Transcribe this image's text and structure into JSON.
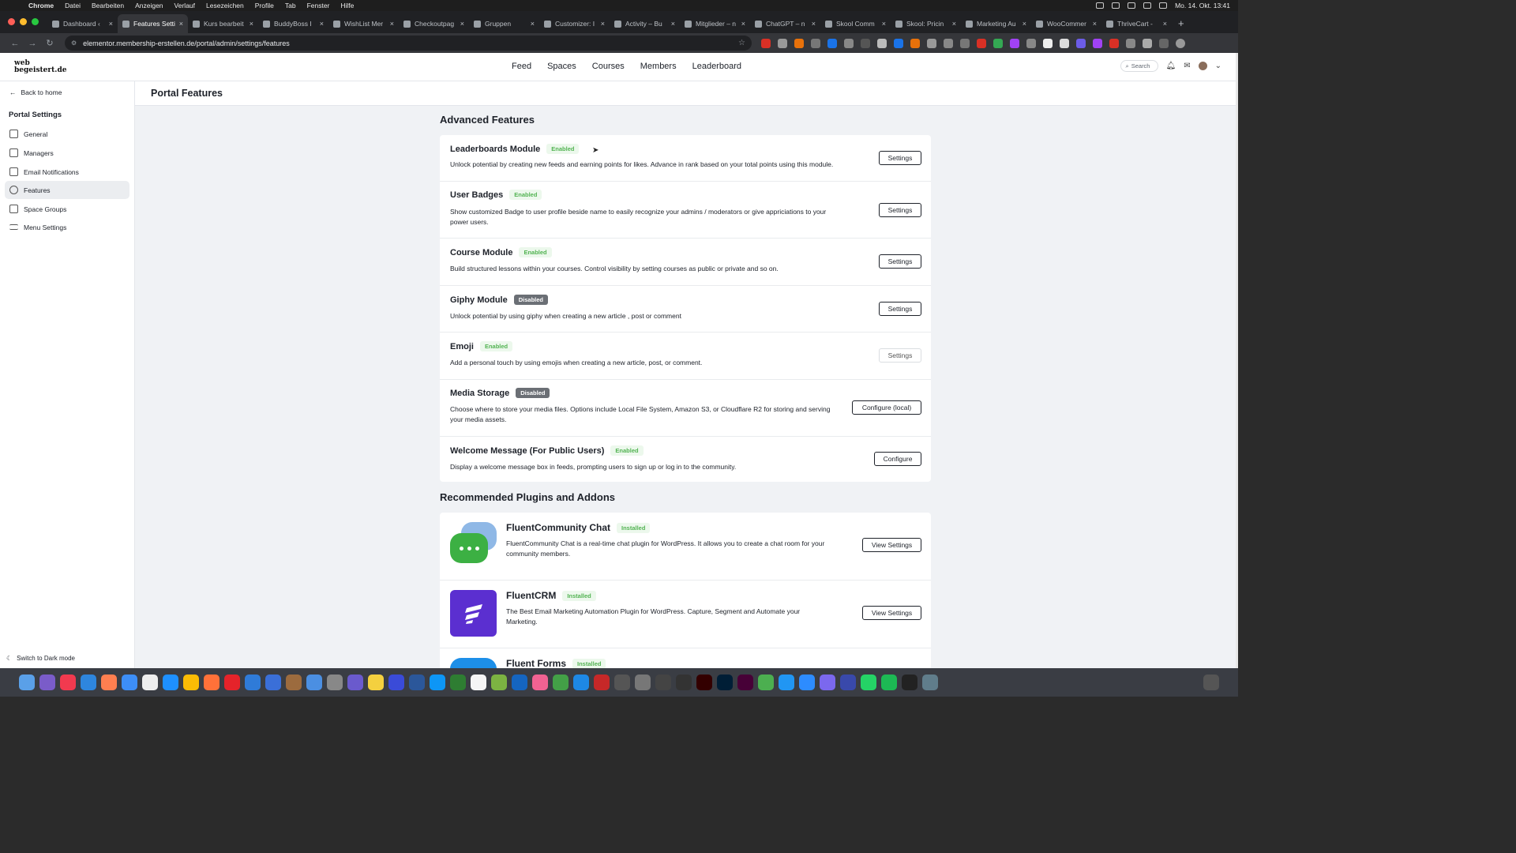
{
  "menubar": {
    "app": "Chrome",
    "items": [
      "Datei",
      "Bearbeiten",
      "Anzeigen",
      "Verlauf",
      "Lesezeichen",
      "Profile",
      "Tab",
      "Fenster",
      "Hilfe"
    ],
    "clock": "Mo. 14. Okt. 13:41"
  },
  "tabs": [
    {
      "title": "Dashboard ‹"
    },
    {
      "title": "Features Setti"
    },
    {
      "title": "Kurs bearbeit"
    },
    {
      "title": "BuddyBoss I"
    },
    {
      "title": "WishList Mer"
    },
    {
      "title": "Checkoutpag"
    },
    {
      "title": "Gruppen"
    },
    {
      "title": "Customizer: I"
    },
    {
      "title": "Activity – Bu"
    },
    {
      "title": "Mitglieder – n"
    },
    {
      "title": "ChatGPT – n"
    },
    {
      "title": "Skool Comm"
    },
    {
      "title": "Skool: Pricin"
    },
    {
      "title": "Marketing Au"
    },
    {
      "title": "WooCommer"
    },
    {
      "title": "ThriveCart -"
    }
  ],
  "address": {
    "url": "elementor.membership-erstellen.de/portal/admin/settings/features"
  },
  "site": {
    "logo_line1": "web",
    "logo_line2": "begeistert.de",
    "nav": [
      "Feed",
      "Spaces",
      "Courses",
      "Members",
      "Leaderboard"
    ],
    "search_placeholder": "Search"
  },
  "sidebar": {
    "back": "Back to home",
    "title": "Portal Settings",
    "items": [
      {
        "label": "General"
      },
      {
        "label": "Managers"
      },
      {
        "label": "Email Notifications"
      },
      {
        "label": "Features"
      },
      {
        "label": "Space Groups"
      },
      {
        "label": "Menu Settings"
      }
    ],
    "dark_mode": "Switch to Dark mode"
  },
  "page": {
    "title": "Portal Features"
  },
  "advanced": {
    "title": "Advanced Features",
    "features": [
      {
        "name": "Leaderboards Module",
        "status": "Enabled",
        "desc": "Unlock potential by creating new feeds and earning points for likes. Advance in rank based on your total points using this module.",
        "button": "Settings"
      },
      {
        "name": "User Badges",
        "status": "Enabled",
        "desc": "Show customized Badge to user profile beside name to easily recognize your admins / moderators or give appriciations to your power users.",
        "button": "Settings"
      },
      {
        "name": "Course Module",
        "status": "Enabled",
        "desc": "Build structured lessons within your courses. Control visibility by setting courses as public or private and so on.",
        "button": "Settings"
      },
      {
        "name": "Giphy Module",
        "status": "Disabled",
        "desc": "Unlock potential by using giphy when creating a new article , post or comment",
        "button": "Settings"
      },
      {
        "name": "Emoji",
        "status": "Enabled",
        "desc": "Add a personal touch by using emojis when creating a new article, post, or comment.",
        "button": "Settings"
      },
      {
        "name": "Media Storage",
        "status": "Disabled",
        "desc": "Choose where to store your media files. Options include Local File System, Amazon S3, or Cloudflare R2 for storing and serving your media assets.",
        "button": "Configure (local)"
      },
      {
        "name": "Welcome Message (For Public Users)",
        "status": "Enabled",
        "desc": "Display a welcome message box in feeds, prompting users to sign up or log in to the community.",
        "button": "Configure"
      }
    ]
  },
  "plugins": {
    "title": "Recommended Plugins and Addons",
    "items": [
      {
        "name": "FluentCommunity Chat",
        "status": "Installed",
        "desc": "FluentCommunity Chat is a real-time chat plugin for WordPress. It allows you to create a chat room for your community members.",
        "button": "View Settings"
      },
      {
        "name": "FluentCRM",
        "status": "Installed",
        "desc": "The Best Email Marketing Automation Plugin for WordPress. Capture, Segment and Automate your Marketing.",
        "button": "View Settings"
      },
      {
        "name": "Fluent Forms",
        "status": "Installed",
        "desc": "",
        "button": ""
      }
    ]
  },
  "colors": {
    "enabled": "#52b352",
    "disabled": "#6b6f75",
    "page_bg": "#f0f2f5"
  }
}
